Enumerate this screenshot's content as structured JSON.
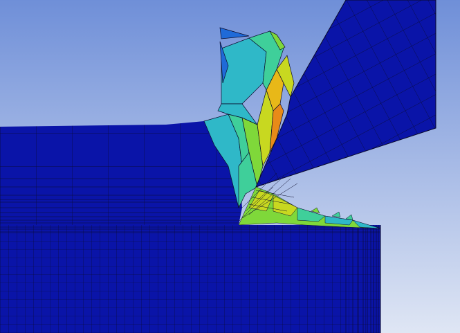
{
  "viewport": {
    "background_gradient": [
      "#6f8fd8",
      "#dfe6f4"
    ],
    "mesh_line_color": "#0a0a2a",
    "contour_palette": [
      "#0a14a8",
      "#1f6ad8",
      "#2fb8c8",
      "#3fcf9a",
      "#7fd83a",
      "#c8d820",
      "#e8b818",
      "#e88a18"
    ]
  }
}
